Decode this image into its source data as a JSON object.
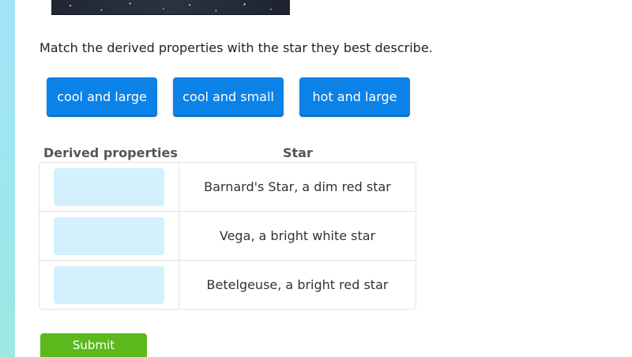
{
  "question": {
    "instruction": "Match the derived properties with the star they best describe."
  },
  "choices": [
    {
      "label": "cool and large"
    },
    {
      "label": "cool and small"
    },
    {
      "label": "hot and large"
    }
  ],
  "table": {
    "headers": {
      "derived": "Derived properties",
      "star": "Star"
    },
    "rows": [
      {
        "star": "Barnard's Star, a dim red star"
      },
      {
        "star": "Vega, a bright white star"
      },
      {
        "star": "Betelgeuse, a bright red star"
      }
    ]
  },
  "submit": {
    "label": "Submit"
  },
  "colors": {
    "choice_tile": "#0b82e8",
    "drop_zone": "#d2f1fd",
    "submit": "#5bb81d",
    "left_rail": "#a4e3f8"
  }
}
